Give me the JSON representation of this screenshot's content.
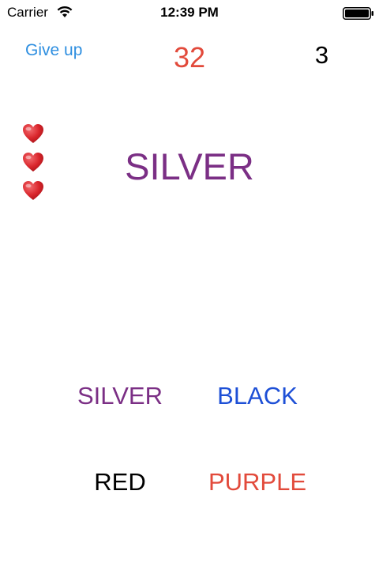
{
  "status_bar": {
    "carrier": "Carrier",
    "time": "12:39 PM",
    "icons": [
      "wifi-icon",
      "battery-icon"
    ]
  },
  "header": {
    "give_up_label": "Give up",
    "timer": "32",
    "score": "3"
  },
  "lives": {
    "count": 3,
    "icon": "heart-icon"
  },
  "prompt": {
    "word": "SILVER",
    "color": "#7b2f85"
  },
  "answers": [
    {
      "label": "SILVER",
      "color": "#7b2f85"
    },
    {
      "label": "BLACK",
      "color": "#1d4fd6"
    },
    {
      "label": "RED",
      "color": "#000000"
    },
    {
      "label": "PURPLE",
      "color": "#e24a3b"
    }
  ],
  "colors": {
    "link": "#2f8fe0",
    "timer": "#e24a3b",
    "heart": "#d9252b"
  }
}
